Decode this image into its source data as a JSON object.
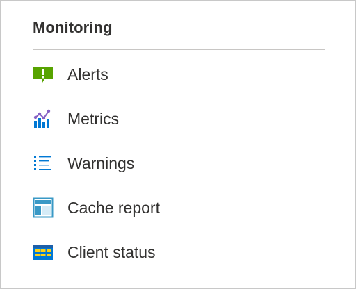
{
  "section": {
    "title": "Monitoring"
  },
  "items": [
    {
      "label": "Alerts",
      "icon": "alert-icon"
    },
    {
      "label": "Metrics",
      "icon": "metrics-chart-icon"
    },
    {
      "label": "Warnings",
      "icon": "list-icon"
    },
    {
      "label": "Cache report",
      "icon": "report-icon"
    },
    {
      "label": "Client status",
      "icon": "grid-table-icon"
    }
  ],
  "colors": {
    "alert_green": "#57a300",
    "metrics_purple": "#8661c5",
    "metrics_blue": "#0078d4",
    "list_blue": "#0078d4",
    "report_blue": "#3999c6",
    "table_yellow": "#fcd116"
  }
}
